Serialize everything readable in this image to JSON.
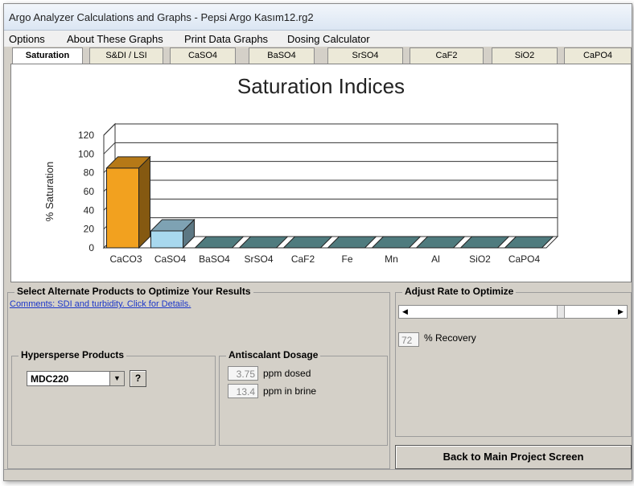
{
  "window": {
    "title": "Argo Analyzer Calculations and Graphs - Pepsi Argo Kasım12.rg2"
  },
  "menu": [
    "Options",
    "About These Graphs",
    "Print Data Graphs",
    "Dosing Calculator"
  ],
  "tabs": [
    "Saturation",
    "S&DI / LSI",
    "CaSO4",
    "BaSO4",
    "SrSO4",
    "CaF2",
    "SiO2",
    "CaPO4"
  ],
  "active_tab": "Saturation",
  "chart_data": {
    "type": "bar",
    "title": "Saturation Indices",
    "ylabel": "% Saturation",
    "xlabel": "",
    "ylim": [
      0,
      120
    ],
    "yticks": [
      "0",
      "20",
      "40",
      "60",
      "80",
      "100",
      "120"
    ],
    "categories": [
      "CaCO3",
      "CaSO4",
      "BaSO4",
      "SrSO4",
      "CaF2",
      "Fe",
      "Mn",
      "Al",
      "SiO2",
      "CaPO4"
    ],
    "values": [
      85,
      18,
      0,
      0,
      0,
      0,
      0,
      0,
      0,
      0
    ],
    "colors": [
      "#f2a11f",
      "#a8d8ee",
      "#4f7b7e",
      "#4f7b7e",
      "#4f7b7e",
      "#4f7b7e",
      "#4f7b7e",
      "#4f7b7e",
      "#4f7b7e",
      "#4f7b7e"
    ],
    "grid": true
  },
  "optimize": {
    "title": "Select Alternate Products to Optimize Your Results",
    "comments": "Comments: SDI and turbidity. Click for Details."
  },
  "products": {
    "title": "Hypersperse Products",
    "selected": "MDC220",
    "help": "?"
  },
  "dosage": {
    "title": "Antiscalant Dosage",
    "dosed_value": "3.75",
    "dosed_label": "ppm dosed",
    "brine_value": "13.4",
    "brine_label": "ppm in brine"
  },
  "rate": {
    "title": "Adjust Rate to Optimize",
    "recovery_value": "72",
    "recovery_label": "% Recovery",
    "slider_fraction": 0.72
  },
  "back_button": "Back to Main Project Screen"
}
